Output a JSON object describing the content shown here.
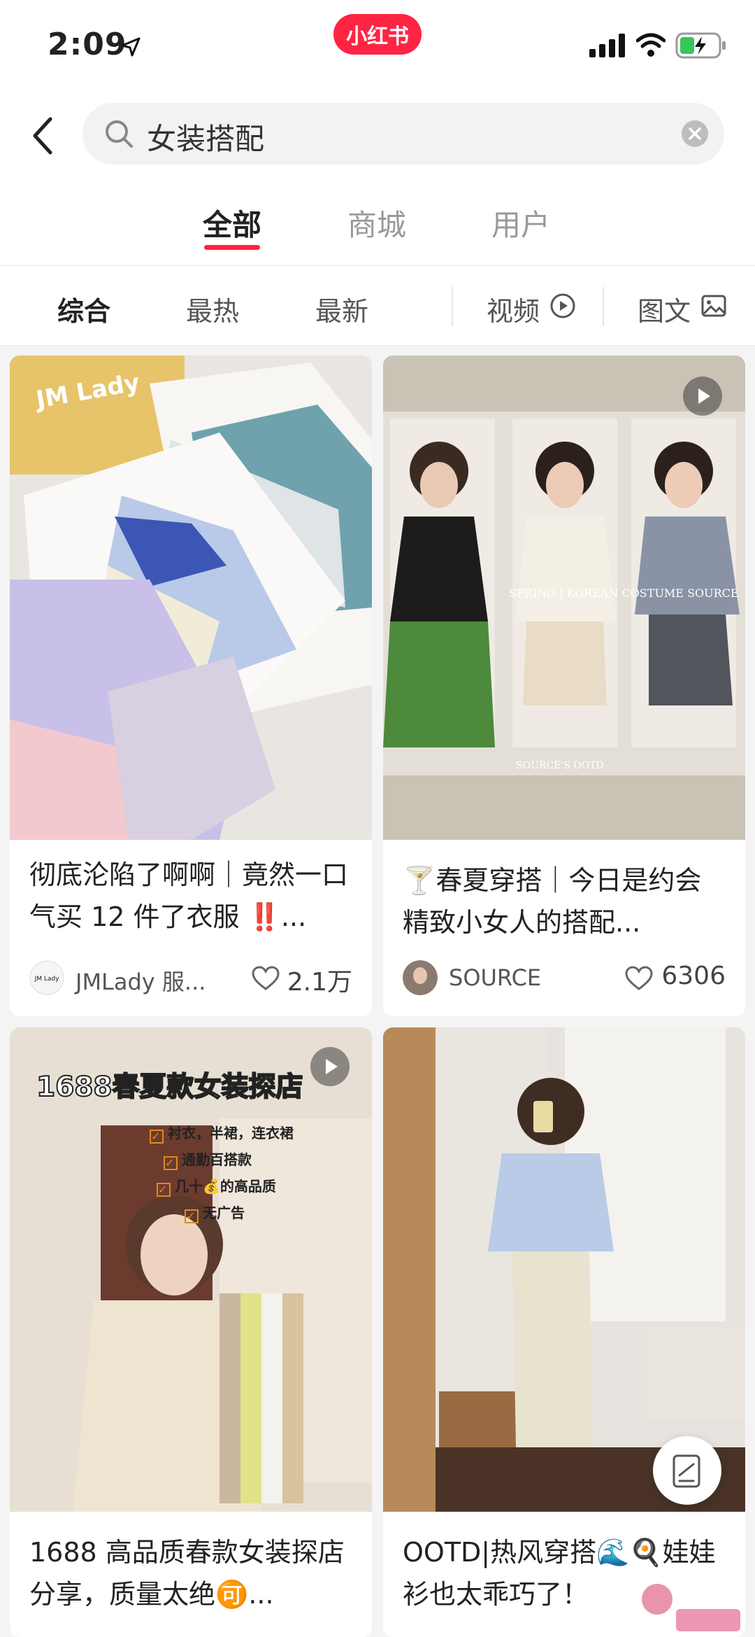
{
  "status_bar": {
    "time": "2:09",
    "brand": "小红书"
  },
  "search": {
    "query": "女装搭配"
  },
  "tabs": [
    {
      "label": "全部",
      "active": true
    },
    {
      "label": "商城",
      "active": false
    },
    {
      "label": "用户",
      "active": false
    }
  ],
  "filters": [
    {
      "label": "综合",
      "active": true
    },
    {
      "label": "最热",
      "active": false
    },
    {
      "label": "最新",
      "active": false
    },
    {
      "label": "视频",
      "icon": "play-circle-icon"
    },
    {
      "label": "图文",
      "icon": "image-icon"
    }
  ],
  "notes": [
    {
      "title": "彻底沦陷了啊啊｜竟然一口气买 12 件了衣服 ‼️...",
      "author": "JMLady 服...",
      "likes": "2.1万",
      "is_video": false
    },
    {
      "title": "🍸春夏穿搭｜今日是约会精致小女人的搭配...",
      "author": "SOURCE",
      "likes": "6306",
      "is_video": true
    },
    {
      "title": "1688 高品质春款女装探店分享，质量太绝🉑...",
      "image_heading": "1688春夏款女装探店",
      "image_list": [
        "衬衣，半裙，连衣裙",
        "通勤百搭款",
        "几十💰的高品质",
        "无广告"
      ],
      "is_video": true
    },
    {
      "title": "OOTD|热风穿搭🌊🍳娃娃衫也太乖巧了！",
      "is_video": false
    }
  ],
  "colors": {
    "accent": "#ff2442",
    "background": "#f4f4f4"
  }
}
